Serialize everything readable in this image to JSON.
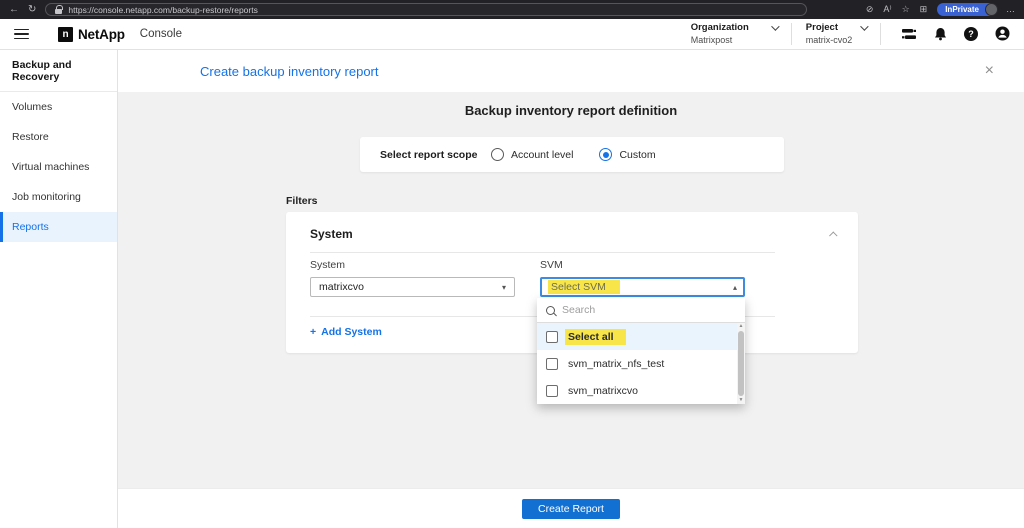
{
  "browser": {
    "url": "https://console.netapp.com/backup-restore/reports",
    "inprivate_label": "InPrivate"
  },
  "icons": {
    "back": "←",
    "refresh": "↻",
    "tracking": "⊘",
    "read_aloud": "A⁾",
    "favorite": "☆",
    "collections": "⊞",
    "ellipsis": "…",
    "close": "×",
    "question": "?",
    "netapp_mark": "n",
    "plus": "+",
    "caret_down": "▾",
    "caret_up": "▴",
    "scroll_up": "▲",
    "scroll_down": "▼"
  },
  "app_header": {
    "brand": "NetApp",
    "product": "Console",
    "organization_label": "Organization",
    "organization_value": "Matrixpost",
    "project_label": "Project",
    "project_value": "matrix-cvo2"
  },
  "sidebar": {
    "header": "Backup and Recovery",
    "items": [
      {
        "label": "Volumes"
      },
      {
        "label": "Restore"
      },
      {
        "label": "Virtual machines"
      },
      {
        "label": "Job monitoring"
      },
      {
        "label": "Reports"
      }
    ]
  },
  "panel": {
    "title": "Create backup inventory report"
  },
  "definition": {
    "heading": "Backup inventory report definition",
    "scope_label": "Select report scope",
    "scope_options": [
      {
        "label": "Account level",
        "selected": false
      },
      {
        "label": "Custom",
        "selected": true
      }
    ]
  },
  "filters": {
    "section_label": "Filters",
    "card_title": "System",
    "system_label": "System",
    "system_value": "matrixcvo",
    "svm_label": "SVM",
    "svm_value": "Select SVM",
    "add_system_label": "Add System",
    "svm_dropdown": {
      "search_placeholder": "Search",
      "options": [
        {
          "label": "Select all",
          "highlighted": true
        },
        {
          "label": "svm_matrix_nfs_test",
          "highlighted": false
        },
        {
          "label": "svm_matrixcvo",
          "highlighted": false
        }
      ]
    }
  },
  "footer": {
    "create_button": "Create Report"
  },
  "colors": {
    "accent_blue": "#1473e6",
    "button_blue": "#1170d2",
    "highlight_yellow": "#f7e549",
    "inprivate_blue": "#3a62d3",
    "selected_row": "#e9f3fd"
  }
}
